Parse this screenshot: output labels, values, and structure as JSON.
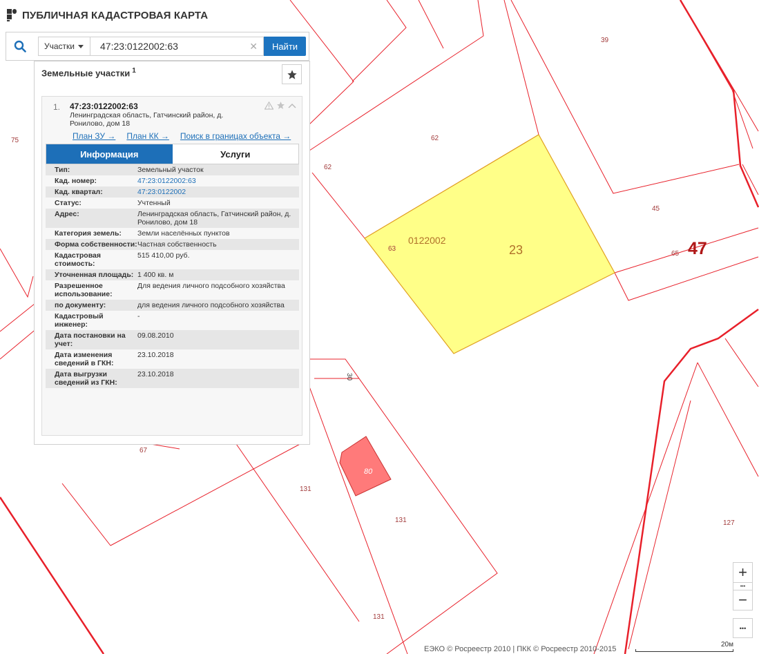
{
  "brand": {
    "title": "ПУБЛИЧНАЯ КАДАСТРОВАЯ КАРТА"
  },
  "search": {
    "type_label": "Участки",
    "query": "47:23:0122002:63",
    "button_label": "Найти"
  },
  "panel": {
    "heading": "Земельные участки",
    "heading_count": "1"
  },
  "card": {
    "index": "1.",
    "cad_number": "47:23:0122002:63",
    "address": "Ленинградская область, Гатчинский район, д. Ронилово, дом 18",
    "links": [
      "План ЗУ →",
      "План КК →",
      "Поиск в границах объекта →"
    ],
    "tabs": {
      "info": "Информация",
      "services": "Услуги"
    },
    "rows": [
      {
        "k": "Тип:",
        "v": "Земельный участок"
      },
      {
        "k": "Кад. номер:",
        "v": "47:23:0122002:63"
      },
      {
        "k": "Кад. квартал:",
        "v": "47:23:0122002"
      },
      {
        "k": "Статус:",
        "v": "Учтенный"
      },
      {
        "k": "Адрес:",
        "v": "Ленинградская область, Гатчинский район, д. Ронилово, дом 18"
      },
      {
        "k": "Категория земель:",
        "v": "Земли населённых пунктов"
      },
      {
        "k": "Форма собственности:",
        "v": "Частная собственность"
      },
      {
        "k": "Кадастровая стоимость:",
        "v": "515 410,00 руб."
      },
      {
        "k": "Уточненная площадь:",
        "v": "1 400 кв. м"
      },
      {
        "k": "Разрешенное использование:",
        "v": "Для ведения личного подсобного хозяйства"
      },
      {
        "k": "по документу:",
        "v": "для ведения личного подсобного хозяйства"
      },
      {
        "k": "Кадастровый инженер:",
        "v": "-"
      },
      {
        "k": "Дата постановки на учет:",
        "v": "09.08.2010"
      },
      {
        "k": "Дата изменения сведений в ГКН:",
        "v": "23.10.2018"
      },
      {
        "k": "Дата выгрузки сведений из ГКН:",
        "v": "23.10.2018"
      }
    ]
  },
  "map": {
    "labels": {
      "l39": "39",
      "l62a": "62",
      "l62b": "62",
      "l75": "75",
      "l45": "45",
      "l65": "65",
      "l47": "47",
      "l63": "63",
      "quarter": "0122002",
      "parcel": "23",
      "l30": "30",
      "l67": "67",
      "l80": "80",
      "l131a": "131",
      "l131b": "131",
      "l131c": "131",
      "l127": "127"
    },
    "colors": {
      "boundary": "#e8202a",
      "selected_fill": "#ffff88",
      "selected_stroke": "#e0a020",
      "building_fill": "#ff7a7a"
    }
  },
  "controls": {
    "zoom_in": "+",
    "zoom_out": "−",
    "more": "•••"
  },
  "footer": {
    "copyright": "ЕЭКО © Росреестр 2010 | ПКК © Росреестр 2010-2015",
    "scale_label": "20м"
  }
}
